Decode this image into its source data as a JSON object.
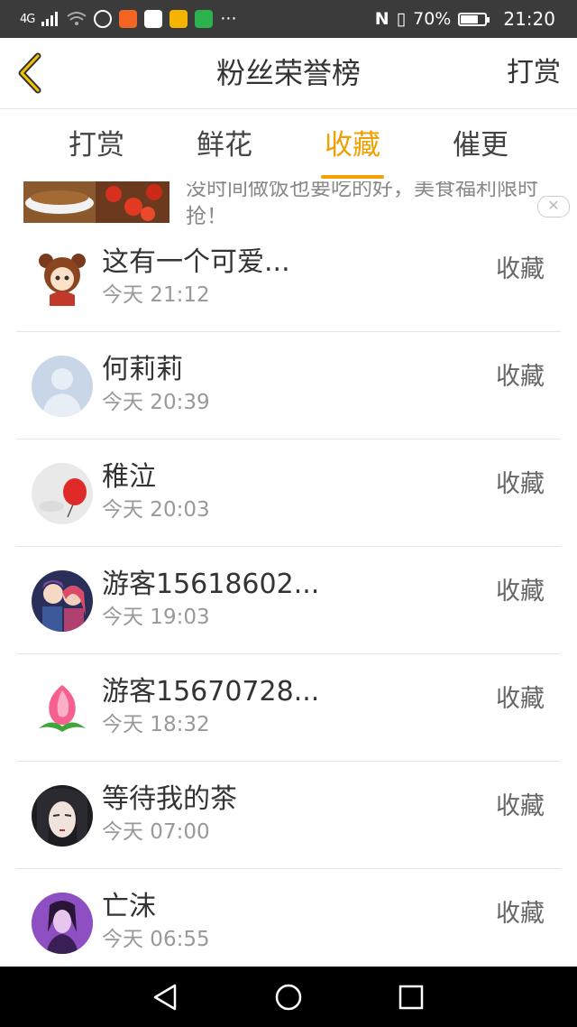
{
  "status_bar": {
    "signal": "4G",
    "battery_percent": "70%",
    "battery_level": 0.7,
    "time": "21:20",
    "app_icons": [
      "k-app-icon",
      "video-app-icon",
      "browser-app-icon",
      "reader-app-icon",
      "iqiyi-app-icon"
    ],
    "more": "···"
  },
  "header": {
    "title": "粉丝荣誉榜",
    "action_label": "打赏"
  },
  "tabs": [
    {
      "label": "打赏",
      "active": false
    },
    {
      "label": "鲜花",
      "active": false
    },
    {
      "label": "收藏",
      "active": true
    },
    {
      "label": "催更",
      "active": false
    }
  ],
  "ad": {
    "text": "没时间做饭也要吃的好，美食福利限时抢！",
    "close": "✕"
  },
  "fans": [
    {
      "name": "这有一个可爱...",
      "time": "今天 21:12",
      "action": "收藏"
    },
    {
      "name": "何莉莉",
      "time": "今天 20:39",
      "action": "收藏"
    },
    {
      "name": "稚泣",
      "time": "今天 20:03",
      "action": "收藏"
    },
    {
      "name": "游客15618602...",
      "time": "今天 19:03",
      "action": "收藏"
    },
    {
      "name": "游客15670728...",
      "time": "今天 18:32",
      "action": "收藏"
    },
    {
      "name": "等待我的茶",
      "time": "今天 07:00",
      "action": "收藏"
    },
    {
      "name": "亡沫",
      "time": "今天 06:55",
      "action": "收藏"
    }
  ],
  "colors": {
    "accent": "#f0a000",
    "status_bar_bg": "#3b3b3b",
    "nav_bar_bg": "#000000"
  }
}
